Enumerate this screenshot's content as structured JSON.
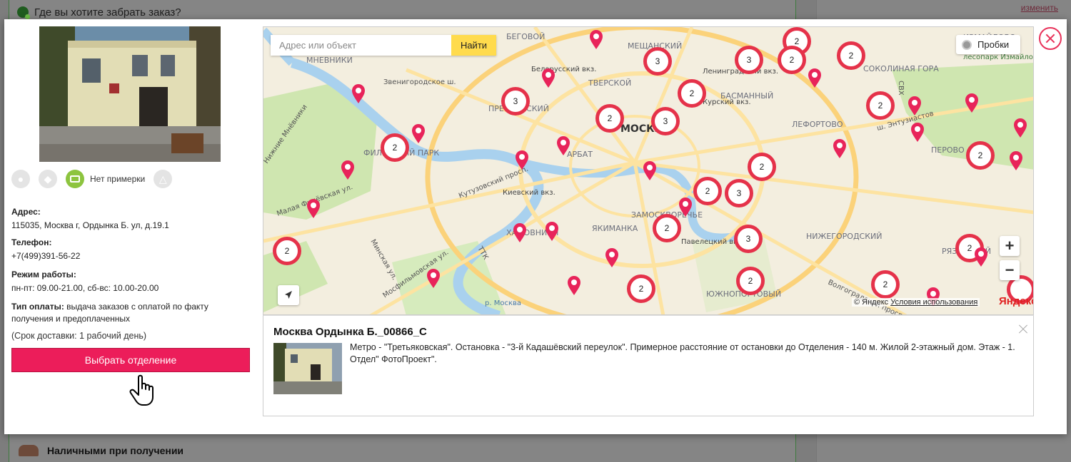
{
  "background": {
    "delivery_question": "Где вы хотите забрать заказ?",
    "change_link": "изменить",
    "cash_option": "Наличными при получении"
  },
  "pickup_point": {
    "features": {
      "no_fitting_label": "Нет примерки"
    },
    "address_label": "Адрес:",
    "address": "115035, Москва г, Ордынка Б. ул, д.19.1",
    "phone_label": "Телефон:",
    "phone": "+7(499)391-56-22",
    "hours_label": "Режим работы:",
    "hours": "пн-пт: 09.00-21.00, сб-вс: 10.00-20.00",
    "payment_label": "Тип оплаты:",
    "payment": "выдача заказов с оплатой по факту получения и предоплаченных",
    "delivery_time": "(Срок доставки: 1 рабочий день)",
    "select_button": "Выбрать отделение"
  },
  "map": {
    "search_placeholder": "Адрес или объект",
    "search_button": "Найти",
    "traffic_button": "Пробки",
    "zoom_in": "+",
    "zoom_out": "−",
    "copyright": "© Яндекс",
    "terms_link": "Условия использования",
    "logo": "Яндекс",
    "district_labels": [
      "БЕГОВОЙ",
      "МЕЩАНСКИЙ",
      "ИЗМАЙЛОВО",
      "МНЕВНИКИ",
      "Белорусский вкз.",
      "Ленинградский вкз.",
      "СОКОЛИНАЯ ГОРА",
      "лесопарк Измайлово",
      "Звенигородское ш.",
      "ТВЕРСКОЙ",
      "БАСМАННЫЙ",
      "ПРЕСНЕНСКИЙ",
      "МОСКВА",
      "Курский вкз.",
      "ЛЕФОРТОВО",
      "ПЕРОВО",
      "ФИЛЁВСКИЙ ПАРК",
      "АРБАТ",
      "Киевский вкз.",
      "Кутузовский просп.",
      "ЗАМОСКВОРЕЧЬЕ",
      "ЯКИМАНКА",
      "ХАМОВНИКИ",
      "Павелецкий вкз.",
      "НИЖЕГОРОДСКИЙ",
      "РЯЗАНСКИЙ",
      "ЮЖНОПОРТОВЫЙ",
      "Волгоградский просп.",
      "р. Москва",
      "Нижние Мнёвники",
      "Малая Филёвская ул.",
      "ТТК",
      "СВХ",
      "ш. Энтузиастов",
      "Мосфильмовская ул.",
      "Минская ул."
    ],
    "clusters": [
      "2",
      "2",
      "3",
      "3",
      "2",
      "2",
      "3",
      "2",
      "3",
      "2",
      "2",
      "2",
      "2",
      "2",
      "3",
      "3",
      "2",
      "2",
      "2",
      "2",
      "2",
      "2"
    ]
  },
  "info_panel": {
    "title": "Москва Ордынка Б._00866_С",
    "description": "Метро - \"Третьяковская\". Остановка - \"3-й Кадашёвский переулок\". Примерное расстояние от остановки до Отделения - 140 м. Жилой 2-этажный дом. Этаж - 1. Отдел\" ФотоПроект\"."
  },
  "colors": {
    "accent": "#ec1d5a",
    "cluster_border": "#e5324a",
    "search_button": "#ffdb4d",
    "feature_active": "#8dc43f"
  }
}
